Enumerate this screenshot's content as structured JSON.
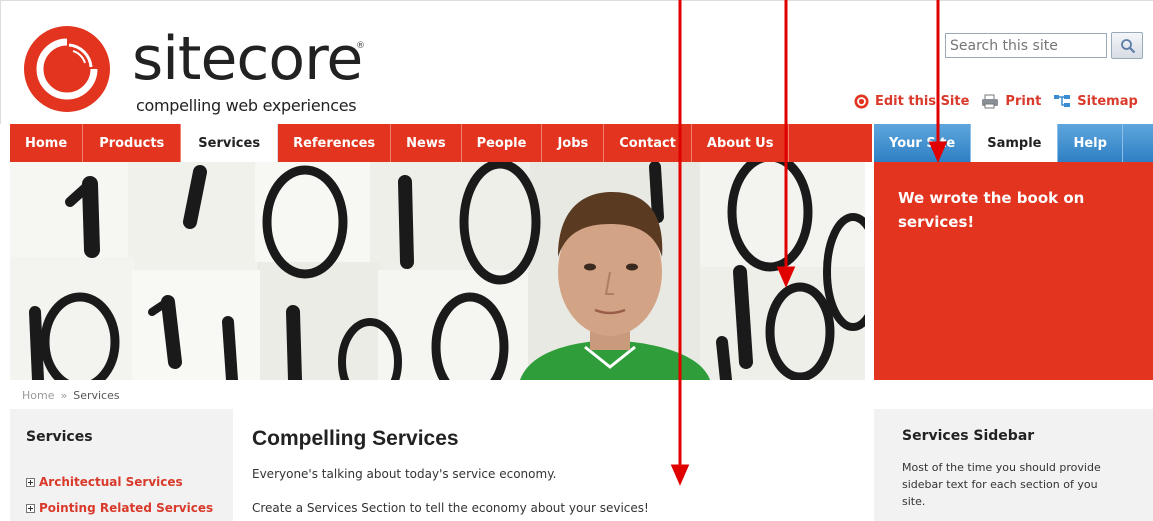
{
  "logo": {
    "wordmark": "sitecore",
    "registered": "®",
    "tagline": "compelling web experiences"
  },
  "search": {
    "placeholder": "Search this site",
    "icon": "magnifier-icon"
  },
  "utility_links": [
    {
      "label": "Edit this Site",
      "icon": "edit-icon"
    },
    {
      "label": "Print",
      "icon": "print-icon"
    },
    {
      "label": "Sitemap",
      "icon": "sitemap-icon"
    }
  ],
  "nav": {
    "main": [
      "Home",
      "Products",
      "Services",
      "References",
      "News",
      "People",
      "Jobs",
      "Contact",
      "About Us"
    ],
    "active": "Services",
    "side": [
      "Your Site",
      "Sample",
      "Help"
    ],
    "side_active": "Sample"
  },
  "hero": {
    "panel_text": "We wrote the book on services!"
  },
  "breadcrumb": {
    "home": "Home",
    "separator": "»",
    "current": "Services"
  },
  "left_sidebar": {
    "title": "Services",
    "items": [
      "Architectual Services",
      "Pointing Related Services"
    ]
  },
  "main": {
    "title": "Compelling Services",
    "paragraphs": [
      "Everyone's talking about today's service economy.",
      "Create a Services Section to tell the economy about your sevices!"
    ]
  },
  "right_sidebar": {
    "title": "Services Sidebar",
    "text": "Most of the time you should provide sidebar text for each section of you site."
  },
  "colors": {
    "brand_red": "#e2341f",
    "link_red": "#d93a2b",
    "nav_blue": "#3a8ccf",
    "annotation_arrow": "#e00000"
  }
}
